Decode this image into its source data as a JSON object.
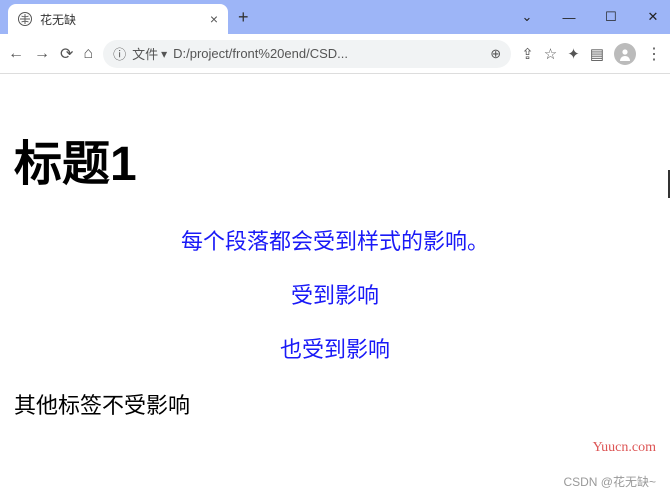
{
  "window": {
    "tab_title": "花无缺",
    "minimize": "—",
    "maximize": "☐",
    "close": "✕"
  },
  "toolbar": {
    "file_label": "文件",
    "url": "D:/project/front%20end/CSD..."
  },
  "content": {
    "h1": "标题1",
    "p1": "每个段落都会受到样式的影响。",
    "p2": "受到影响",
    "p3": "也受到影响",
    "plain": "其他标签不受影响"
  },
  "watermark": {
    "right": "Yuucn.com",
    "bottom": "CSDN @花无缺~"
  }
}
